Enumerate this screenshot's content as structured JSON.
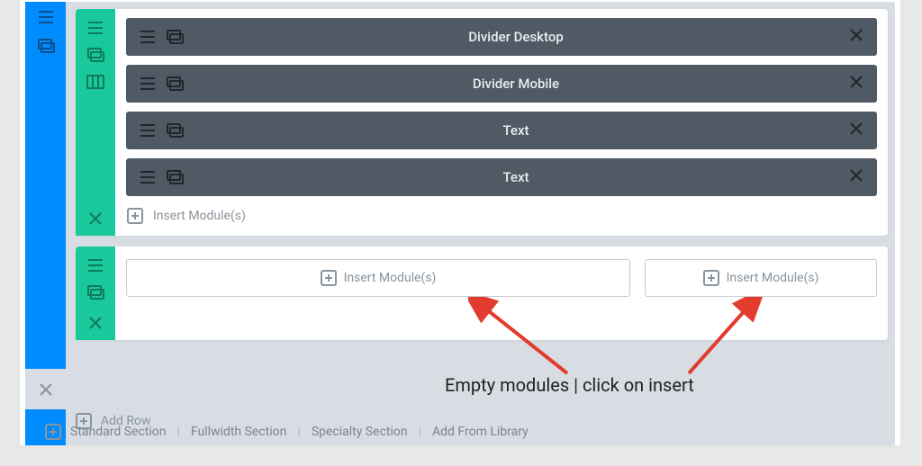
{
  "section": {
    "rail": {
      "close_icon": "close"
    }
  },
  "rows": [
    {
      "modules": [
        {
          "label": "Divider Desktop"
        },
        {
          "label": "Divider Mobile"
        },
        {
          "label": "Text"
        },
        {
          "label": "Text"
        }
      ],
      "insert_label": "Insert Module(s)"
    },
    {
      "columns": [
        {
          "insert_label": "Insert Module(s)"
        },
        {
          "insert_label": "Insert Module(s)"
        }
      ]
    }
  ],
  "add_row_label": "Add Row",
  "footer": {
    "items": [
      "Standard Section",
      "Fullwidth Section",
      "Specialty Section",
      "Add From Library"
    ],
    "sep": "|"
  },
  "annotation": {
    "text": "Empty modules | click on insert"
  },
  "colors": {
    "section_rail": "#008cff",
    "row_rail": "#19c99c",
    "module_bg": "#4f5a65",
    "annotation_arrow": "#e33b2e"
  }
}
